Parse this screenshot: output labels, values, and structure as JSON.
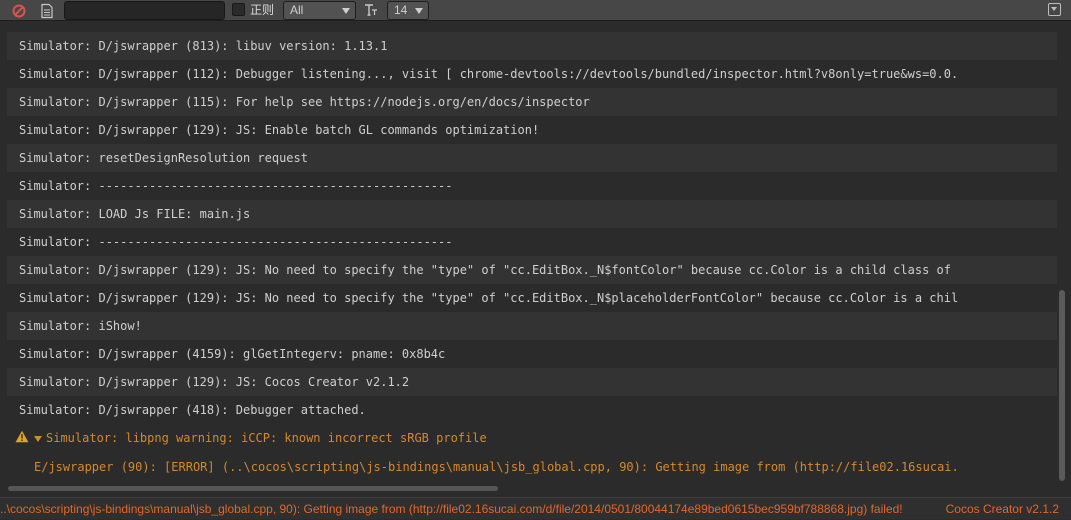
{
  "toolbar": {
    "filter_value": "",
    "regex_label": "正则",
    "level_filter": "All",
    "font_size": "14",
    "icons": [
      "clear-icon",
      "open-log-file-icon",
      "font-size-icon",
      "collapse-icon"
    ]
  },
  "log": {
    "rows": [
      "Simulator: D/jswrapper (813): libuv version: 1.13.1",
      "Simulator: D/jswrapper (112): Debugger listening..., visit [ chrome-devtools://devtools/bundled/inspector.html?v8only=true&ws=0.0.",
      "Simulator: D/jswrapper (115): For help see https://nodejs.org/en/docs/inspector",
      "Simulator: D/jswrapper (129): JS: Enable batch GL commands optimization!",
      "Simulator: resetDesignResolution request",
      "Simulator: -------------------------------------------------",
      "Simulator: LOAD Js FILE: main.js",
      "Simulator: -------------------------------------------------",
      "Simulator: D/jswrapper (129): JS: No need to specify the \"type\" of \"cc.EditBox._N$fontColor\" because cc.Color is a child class of",
      "Simulator: D/jswrapper (129): JS: No need to specify the \"type\" of \"cc.EditBox._N$placeholderFontColor\" because cc.Color is a chil",
      "Simulator: iShow!",
      "Simulator: D/jswrapper (4159): glGetIntegerv: pname: 0x8b4c",
      "Simulator: D/jswrapper (129): JS: Cocos Creator v2.1.2",
      "Simulator: D/jswrapper (418): Debugger attached."
    ],
    "warning": {
      "summary": "Simulator: libpng warning: iCCP: known incorrect sRGB profile",
      "detail": "E/jswrapper (90): [ERROR] (..\\cocos\\scripting\\js-bindings\\manual\\jsb_global.cpp, 90): Getting image from (http://file02.16sucai."
    }
  },
  "status": {
    "message": "..\\cocos\\scripting\\js-bindings\\manual\\jsb_global.cpp, 90): Getting image from (http://file02.16sucai.com/d/file/2014/0501/80044174e89bed0615bec959bf788868.jpg) failed!",
    "version": "Cocos Creator v2.1.2"
  },
  "colors": {
    "background": "#2b2b2b",
    "row_alt": "#333333",
    "text": "#cfcfcf",
    "warning": "#d4892b",
    "status_error": "#e2672b",
    "clear_icon": "#d9534f"
  }
}
